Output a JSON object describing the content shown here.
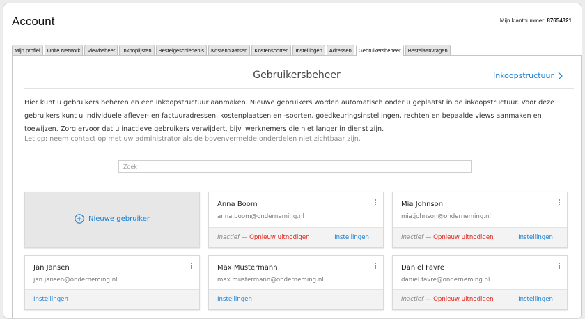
{
  "header": {
    "title": "Account",
    "customer_label": "Mijn klantnummer:",
    "customer_number": "87654321"
  },
  "tabs": [
    {
      "label": "Mijn profiel"
    },
    {
      "label": "Unite Network"
    },
    {
      "label": "Viewbeheer"
    },
    {
      "label": "Inkooplijsten"
    },
    {
      "label": "Bestelgeschiedenis"
    },
    {
      "label": "Kostenplaatsen"
    },
    {
      "label": "Kostensoorten"
    },
    {
      "label": "Instellingen"
    },
    {
      "label": "Adressen"
    },
    {
      "label": "Gebruikersbeheer",
      "active": true
    },
    {
      "label": "Bestelaanvragen"
    }
  ],
  "section": {
    "title": "Gebruikersbeheer",
    "structure_link": "Inkoopstructuur",
    "description": "Hier kunt u gebruikers beheren en een inkoopstructuur aanmaken. Nieuwe gebruikers worden automatisch onder u geplaatst in de inkoopstructuur. Voor deze gebruikers kunt u individuele aflever- en factuuradressen, kostenplaatsen en -soorten, goedkeuringsinstellingen, rechten en bepaalde views aanmaken en toewijzen. Zorg ervoor dat u inactieve gebruikers verwijdert, bijv. werknemers die niet langer in dienst zijn.",
    "note": "Let op: neem contact op met uw administrator als de bovenvermelde onderdelen niet zichtbaar zijn."
  },
  "search": {
    "placeholder": "Zoek",
    "value": ""
  },
  "new_user": {
    "label": "Nieuwe gebruiker"
  },
  "labels": {
    "inactive": "Inactief",
    "dash": "—",
    "reinvite": "Opnieuw uitnodigen",
    "settings": "Instellingen"
  },
  "users": [
    {
      "name": "Anna Boom",
      "email": "anna.boom@onderneming.nl",
      "status": "inactive"
    },
    {
      "name": "Mia Johnson",
      "email": "mia.johnson@onderneming.nl",
      "status": "inactive"
    },
    {
      "name": "Jan Jansen",
      "email": "jan.jansen@onderneming.nl",
      "status": "active"
    },
    {
      "name": "Max Mustermann",
      "email": "max.mustermann@onderneming.nl",
      "status": "active"
    },
    {
      "name": "Daniel Favre",
      "email": "daniel.favre@onderneming.nl",
      "status": "inactive"
    }
  ],
  "colors": {
    "accent": "#1a7fd3",
    "danger": "#e0241b"
  },
  "icons": {
    "new_user": "plus-circle-icon",
    "structure": "chevron-right-icon",
    "card_menu": "vertical-dots-icon"
  }
}
